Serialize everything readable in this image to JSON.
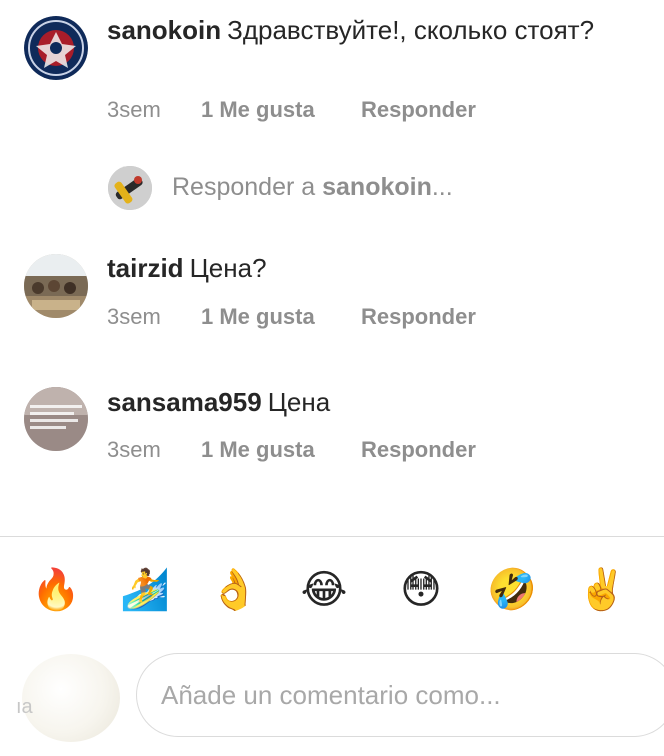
{
  "comments": [
    {
      "username": "sanokoin",
      "text": "Здравствуйте!, сколько стоят?",
      "time": "3sem",
      "likes": "1 Me gusta",
      "reply": "Responder"
    },
    {
      "username": "tairzid",
      "text": "Цена?",
      "time": "3sem",
      "likes": "1 Me gusta",
      "reply": "Responder"
    },
    {
      "username": "sansama959",
      "text": "Цена",
      "time": "3sem",
      "likes": "1 Me gusta",
      "reply": "Responder"
    }
  ],
  "reply_prompt": {
    "prefix": "Responder a ",
    "username": "sanokoin",
    "suffix": "..."
  },
  "emoji_bar": [
    {
      "icon": "fire-emoji",
      "glyph": "🔥"
    },
    {
      "icon": "surfer-emoji",
      "glyph": "🏄"
    },
    {
      "icon": "ok-hand-emoji",
      "glyph": "👌"
    },
    {
      "icon": "joy-emoji",
      "glyph": "😂"
    },
    {
      "icon": "flushed-emoji",
      "glyph": "😳"
    },
    {
      "icon": "rofl-emoji",
      "glyph": "🤣"
    },
    {
      "icon": "victory-hand-emoji",
      "glyph": "✌️"
    }
  ],
  "composer": {
    "placeholder": "Añade un comentario como...",
    "avatar_mark": "ıа"
  }
}
